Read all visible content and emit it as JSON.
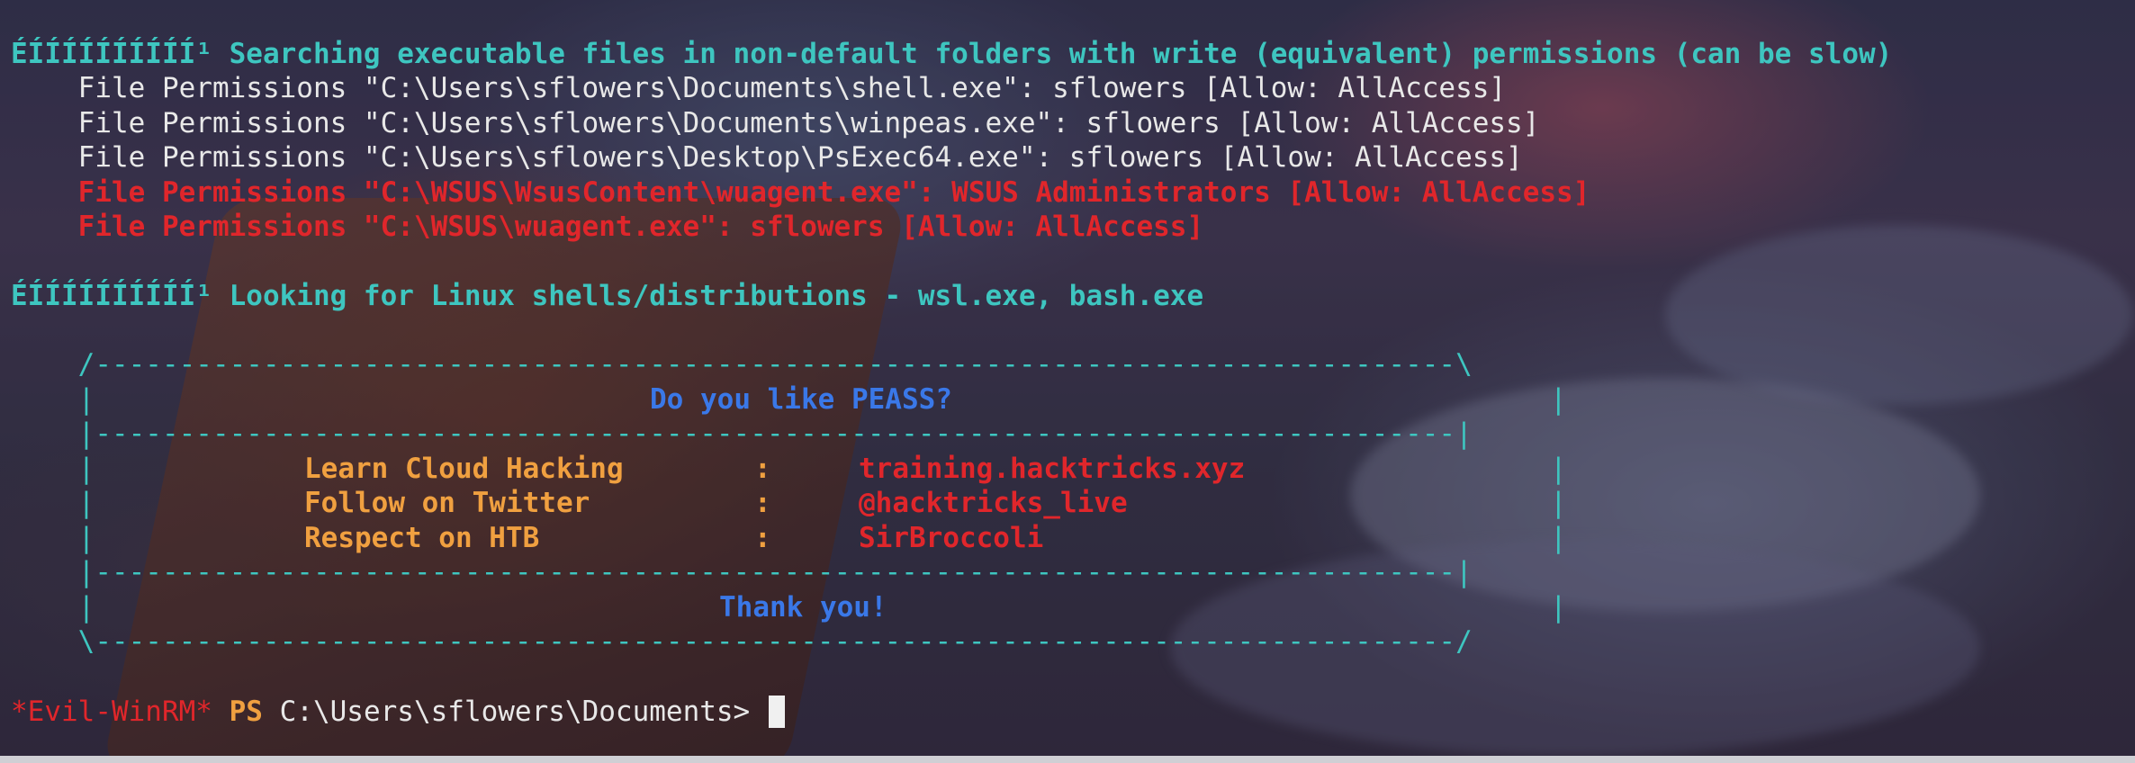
{
  "terminal": {
    "section1": {
      "header": "ÉÍÍÍÍÍÍÍÍÍÍ¹ Searching executable files in non-default folders with write (equivalent) permissions (can be slow)",
      "lines": [
        "    File Permissions \"C:\\Users\\sflowers\\Documents\\shell.exe\": sflowers [Allow: AllAccess]",
        "    File Permissions \"C:\\Users\\sflowers\\Documents\\winpeas.exe\": sflowers [Allow: AllAccess]",
        "    File Permissions \"C:\\Users\\sflowers\\Desktop\\PsExec64.exe\": sflowers [Allow: AllAccess]"
      ],
      "red_lines": [
        "    File Permissions \"C:\\WSUS\\WsusContent\\wuagent.exe\": WSUS Administrators [Allow: AllAccess]",
        "    File Permissions \"C:\\WSUS\\wuagent.exe\": sflowers [Allow: AllAccess]"
      ]
    },
    "section2": {
      "header": "ÉÍÍÍÍÍÍÍÍÍÍ¹ Looking for Linux shells/distributions - wsl.exe, bash.exe"
    },
    "banner": {
      "top": "    /---------------------------------------------------------------------------------\\",
      "side_open": "    |",
      "side_close": "|",
      "sep": "    |---------------------------------------------------------------------------------|",
      "bottom": "    \\---------------------------------------------------------------------------------/",
      "title": "Do you like PEASS?",
      "rows": [
        {
          "label": "Learn Cloud Hacking",
          "sep": ":",
          "value": "training.hacktricks.xyz"
        },
        {
          "label": "Follow on Twitter",
          "sep": ":",
          "value": "@hacktricks_live"
        },
        {
          "label": "Respect on HTB",
          "sep": ":",
          "value": "SirBroccoli"
        }
      ],
      "thanks": "Thank you!"
    },
    "prompt": {
      "shell": "*Evil-WinRM*",
      "ps": "PS",
      "path": "C:\\Users\\sflowers\\Documents>"
    }
  },
  "colors": {
    "cyan": "#3ec6c0",
    "red": "#e0262b",
    "orange": "#f0a040",
    "blue": "#3a78e8",
    "white": "#e8e8e8"
  }
}
